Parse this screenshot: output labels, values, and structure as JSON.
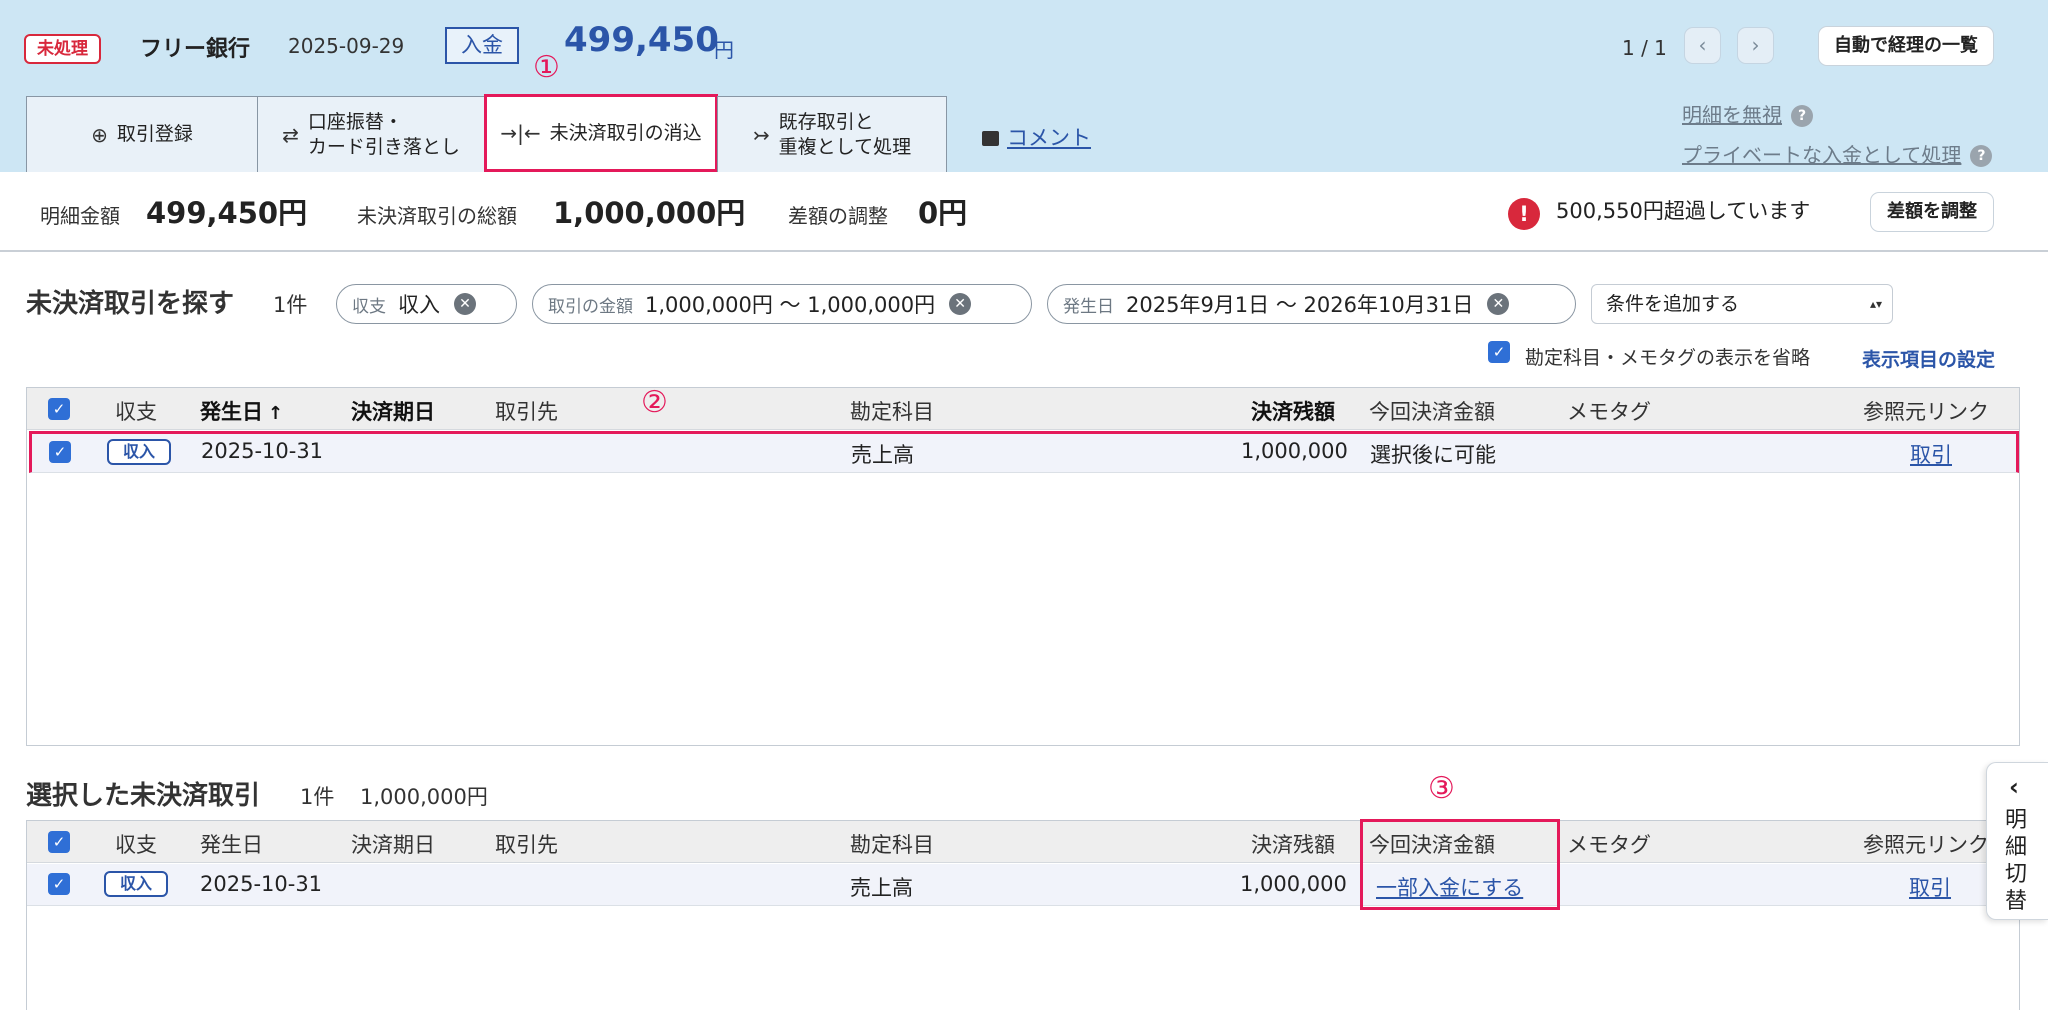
{
  "header": {
    "status_badge": "未処理",
    "bank_name": "フリー銀行",
    "date": "2025-09-29",
    "deposit_type": "入金",
    "amount": "499,450",
    "currency": "円",
    "page_info": "1 / 1",
    "prev_icon": "chevron-left-icon",
    "next_icon": "chevron-right-icon",
    "auto_list_button": "自動で経理の一覧"
  },
  "tabs": [
    {
      "label_1": "取引登録",
      "label_2": "",
      "icon": "plus-circle-icon"
    },
    {
      "label_1": "口座振替・",
      "label_2": "カード引き落とし",
      "icon": "transfer-arrows-icon"
    },
    {
      "label_1": "未決済取引の消込",
      "label_2": "",
      "icon": "merge-arrows-icon"
    },
    {
      "label_1": "既存取引と",
      "label_2": "重複として処理",
      "icon": "duplicate-arrow-icon"
    }
  ],
  "annotations": {
    "mark1": "①",
    "mark2": "②",
    "mark3": "③"
  },
  "comment_link": "コメント",
  "ignore_link": "明細を無視",
  "private_deposit_link": "プライベートな入金として処理",
  "summary": {
    "detail_amount_label": "明細金額",
    "detail_amount": "499,450円",
    "unsettled_total_label": "未決済取引の総額",
    "unsettled_total": "1,000,000円",
    "difference_label": "差額の調整",
    "difference": "0円",
    "warning_icon": "exclamation-icon",
    "warning_text": "500,550円超過しています",
    "adjust_button": "差額を調整"
  },
  "colors": {
    "accent": "#2b55a8",
    "header_bg": "#cde6f4",
    "alert_red": "#d8283c",
    "annotation_pink": "#e4195a",
    "checkbox_blue": "#2f6fd6"
  },
  "search": {
    "title": "未決済取引を探す",
    "count": "1件",
    "filters": [
      {
        "label": "収支",
        "value": "収入"
      },
      {
        "label": "取引の金額",
        "value": "1,000,000円 〜 1,000,000円"
      },
      {
        "label": "発生日",
        "value": "2025年9月1日 〜 2026年10月31日"
      }
    ],
    "add_condition": "条件を追加する",
    "omit_checkbox_label": "勘定科目・メモタグの表示を省略",
    "omit_checked": true,
    "settings_link": "表示項目の設定"
  },
  "table1": {
    "columns": [
      "収支",
      "発生日",
      "決済期日",
      "取引先",
      "勘定科目",
      "決済残額",
      "今回決済金額",
      "メモタグ",
      "参照元リンク"
    ],
    "sort_icon": "↑",
    "rows": [
      {
        "checked": true,
        "type": "収入",
        "date": "2025-10-31",
        "due": "",
        "partner": "",
        "account": "売上高",
        "balance": "1,000,000",
        "this_amount": "選択後に可能",
        "memo": "",
        "link": "取引"
      }
    ]
  },
  "selected": {
    "title": "選択した未決済取引",
    "count": "1件",
    "total": "1,000,000円"
  },
  "table2": {
    "columns": [
      "収支",
      "発生日",
      "決済期日",
      "取引先",
      "勘定科目",
      "決済残額",
      "今回決済金額",
      "メモタグ",
      "参照元リンク"
    ],
    "rows": [
      {
        "checked": true,
        "type": "収入",
        "date": "2025-10-31",
        "due": "",
        "partner": "",
        "account": "売上高",
        "balance": "1,000,000",
        "this_amount": "一部入金にする",
        "memo": "",
        "link": "取引"
      }
    ]
  },
  "drawer": {
    "label": "明細切替",
    "icon": "chevron-left-icon"
  }
}
